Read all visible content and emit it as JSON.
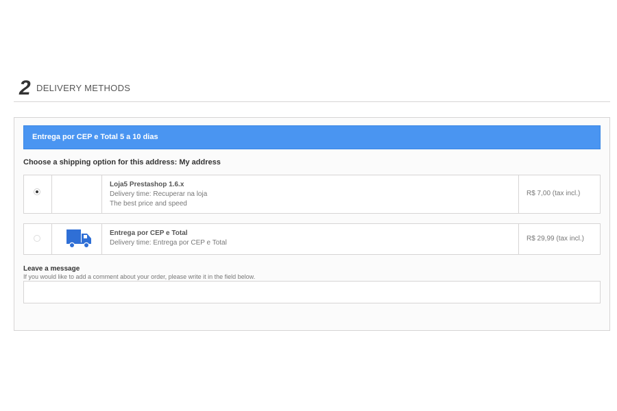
{
  "step": {
    "number": "2",
    "title": "DELIVERY METHODS"
  },
  "carrier_banner": "Entrega por CEP e Total 5 a 10 dias",
  "choose_label": "Choose a shipping option for this address: My address",
  "options": [
    {
      "selected": true,
      "name": "Loja5 Prestashop 1.6.x",
      "delivery_time": "Delivery time: Recuperar na loja",
      "note": "The best price and speed",
      "price": "R$ 7,00 (tax incl.)",
      "logo": null
    },
    {
      "selected": false,
      "name": "Entrega por CEP e Total",
      "delivery_time": "Delivery time: Entrega por CEP e Total",
      "price": "R$ 29,99 (tax incl.)",
      "logo": "truck-icon"
    }
  ],
  "message": {
    "title": "Leave a message",
    "help": "If you would like to add a comment about your order, please write it in the field below.",
    "value": ""
  },
  "colors": {
    "banner": "#4a95f1",
    "truck": "#2f6fd6"
  }
}
